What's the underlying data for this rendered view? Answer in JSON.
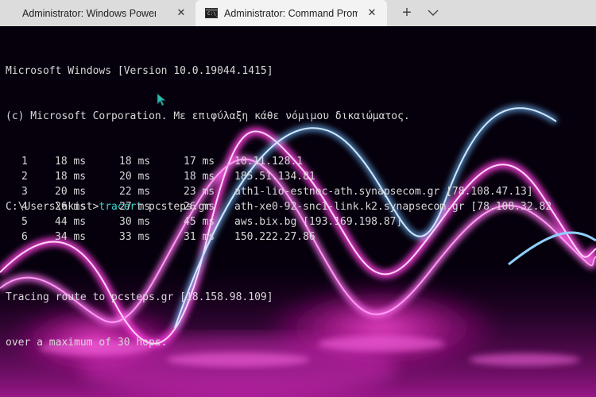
{
  "tabs": [
    {
      "title": "Administrator: Windows PowerShe",
      "close_icon": "close-icon"
    },
    {
      "title": "Administrator: Command Promp",
      "icon": "cmd-icon",
      "icon_text": "C:\\_",
      "close_icon": "close-icon"
    }
  ],
  "toolbar": {
    "new_tab_label": "+",
    "menu_icon": "chevron-down-icon"
  },
  "terminal": {
    "banner_line1": "Microsoft Windows [Version 10.0.19044.1415]",
    "banner_line2": "(c) Microsoft Corporation. Με επιφύλαξη κάθε νόμιμου δικαιώματος.",
    "prompt": "C:\\Users\\akist>",
    "command": "tracert",
    "command_arg": " pcsteps.gr",
    "trace_line1": "Tracing route to pcsteps.gr [18.158.98.109]",
    "trace_line2": "over a maximum of 30 hops:",
    "hops": [
      {
        "num": "1",
        "r1": "18 ms",
        "r2": "18 ms",
        "r3": "17 ms",
        "host": "10.11.128.1"
      },
      {
        "num": "2",
        "r1": "18 ms",
        "r2": "20 ms",
        "r3": "18 ms",
        "host": "185.51.134.81"
      },
      {
        "num": "3",
        "r1": "20 ms",
        "r2": "22 ms",
        "r3": "23 ms",
        "host": "ath1-lio-estnoc-ath.synapsecom.gr [78.108.47.13]"
      },
      {
        "num": "4",
        "r1": "26 ms",
        "r2": "27 ms",
        "r3": "26 ms",
        "host": "ath-xe0-92-snc1-link.k2.synapsecom.gr [78.108.32.82"
      },
      {
        "num": "5",
        "r1": "44 ms",
        "r2": "30 ms",
        "r3": "45 ms",
        "host": "aws.bix.bg [193.169.198.87]"
      },
      {
        "num": "6",
        "r1": "34 ms",
        "r2": "33 ms",
        "r3": "31 ms",
        "host": "150.222.27.86"
      }
    ]
  },
  "colors": {
    "tab_bar": "#dcdcdc",
    "active_tab": "#f3f3f3",
    "command_highlight": "#3ad4cd",
    "terminal_text": "#d8d8d8",
    "cursor": "#2fb8b0"
  }
}
